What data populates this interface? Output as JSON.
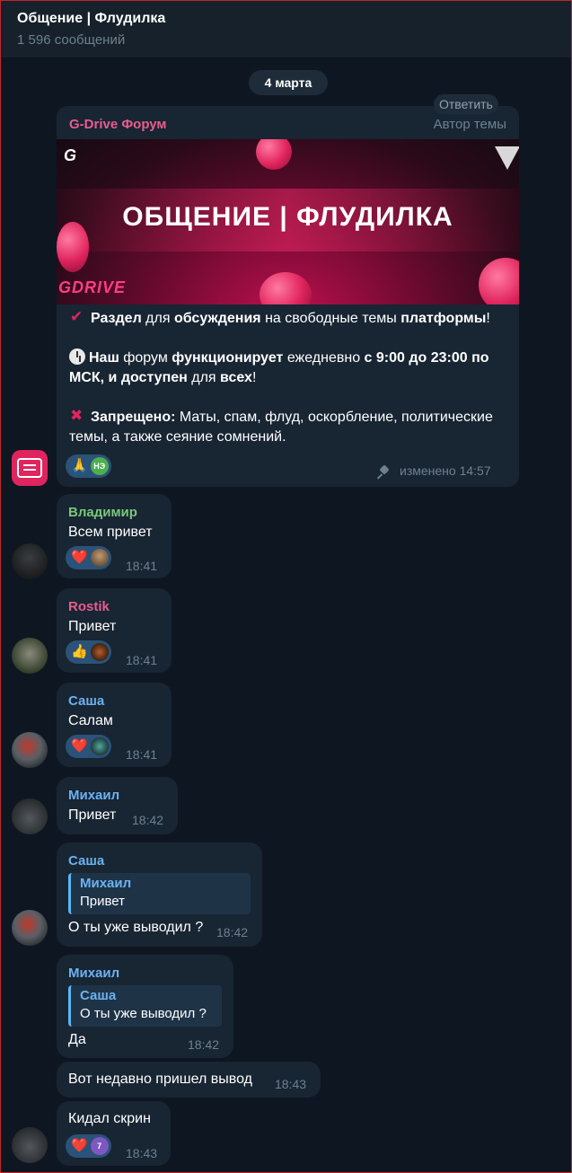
{
  "header": {
    "title": "Общение | Флудилка",
    "subtitle": "1 596 сообщений"
  },
  "date_separator": "4 марта",
  "pinned_post": {
    "sender": "G-Drive Форум",
    "reply_label": "Ответить",
    "role": "Автор темы",
    "banner": {
      "logo": "G",
      "title": "ОБЩЕНИЕ | ФЛУДИЛКА",
      "brand": "GDRIVE"
    },
    "body": {
      "p1": {
        "b1": "Раздел",
        "t1": " для ",
        "b2": "обсуждения",
        "t2": " на свободные темы ",
        "b3": "платформы",
        "t3": "!"
      },
      "p2": {
        "b1": "Наш",
        "t1": " форум ",
        "b2": "функционирует",
        "t2": " ежедневно ",
        "b3": "с 9:00 до 23:00 по МСК, и доступен",
        "t3": " для ",
        "b4": "всех",
        "t4": "!"
      },
      "p3": {
        "b1": "Запрещено:",
        "t1": " Маты, спам, флуд, оскорбление, политические темы, а также сеяние сомнений."
      }
    },
    "reaction_emoji": "🙏",
    "reaction_badge": "НЭ",
    "edited": "изменено 14:57"
  },
  "messages": [
    {
      "sender": "Владимир",
      "sender_color": "#7ac77a",
      "text": "Всем привет",
      "reaction": "❤️",
      "time": "18:41"
    },
    {
      "sender": "Rostik",
      "sender_color": "#e75d8f",
      "text": "Привет",
      "reaction": "👍",
      "time": "18:41"
    },
    {
      "sender": "Саша",
      "sender_color": "#6ab2f2",
      "text": "Салам",
      "reaction": "❤️",
      "time": "18:41"
    },
    {
      "sender": "Михаил",
      "sender_color": "#6ab2f2",
      "text": "Привет",
      "time": "18:42"
    },
    {
      "sender": "Саша",
      "sender_color": "#6ab2f2",
      "quote_name": "Михаил",
      "quote_text": "Привет",
      "text": "О ты уже выводил ?",
      "time": "18:42"
    },
    {
      "sender": "Михаил",
      "sender_color": "#6ab2f2",
      "quote_name": "Саша",
      "quote_text": "О ты уже выводил ?",
      "text": "Да",
      "time": "18:42"
    },
    {
      "text": "Вот недавно пришел вывод",
      "time": "18:43"
    },
    {
      "text": "Кидал скрин",
      "reaction": "❤️",
      "reaction_badge": "7",
      "time": "18:43"
    }
  ]
}
